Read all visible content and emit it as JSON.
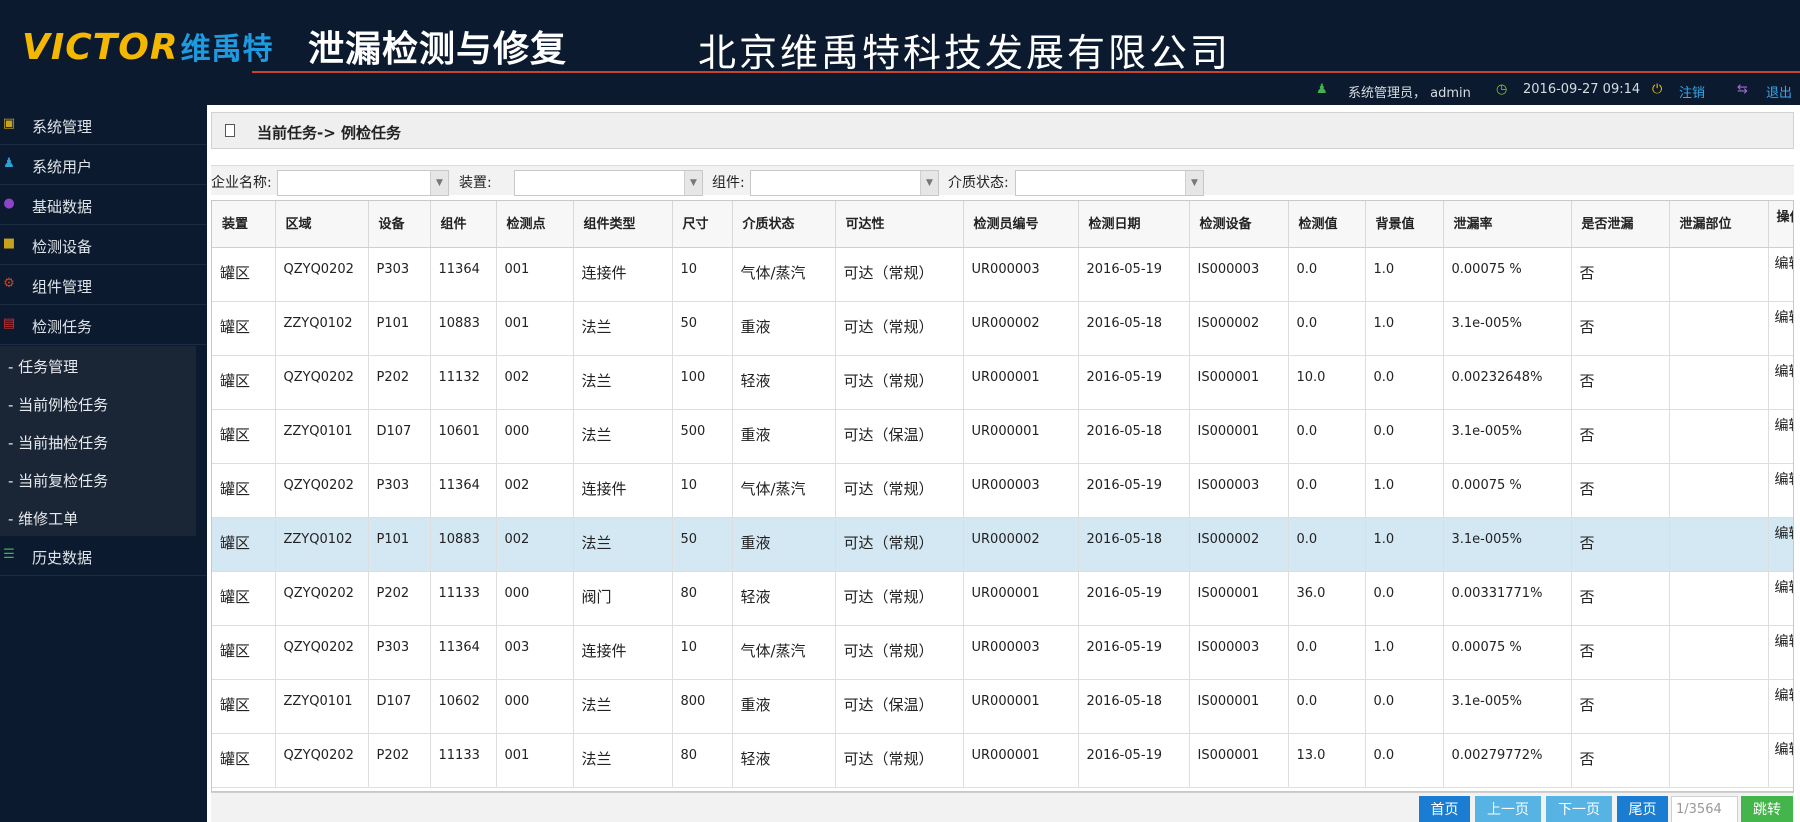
{
  "header": {
    "logo_text": "VICTOR",
    "logo_cn": "维禹特",
    "system_title": "泄漏检测与修复",
    "company": "北京维禹特科技发展有限公司"
  },
  "userbar": {
    "user": "系统管理员， admin",
    "datetime": "2016-09-27 09:14",
    "logout": "注销",
    "exit": "退出"
  },
  "sidebar": {
    "items": [
      {
        "label": "系统管理",
        "icon": "settings-icon"
      },
      {
        "label": "系统用户",
        "icon": "users-icon"
      },
      {
        "label": "基础数据",
        "icon": "globe-icon"
      },
      {
        "label": "检测设备",
        "icon": "truck-icon"
      },
      {
        "label": "组件管理",
        "icon": "cogs-icon"
      },
      {
        "label": "检测任务",
        "icon": "task-icon"
      }
    ],
    "subitems": [
      "- 任务管理",
      "- 当前例检任务",
      "- 当前抽检任务",
      "- 当前复检任务",
      "- 维修工单"
    ],
    "history": {
      "label": "历史数据",
      "icon": "list-icon"
    }
  },
  "breadcrumb": "当前任务-> 例检任务",
  "filters": [
    {
      "label": "企业名称:",
      "value": ""
    },
    {
      "label": "装置:",
      "value": ""
    },
    {
      "label": "组件:",
      "value": ""
    },
    {
      "label": "介质状态:",
      "value": ""
    }
  ],
  "table": {
    "columns": [
      "装置",
      "区域",
      "设备",
      "组件",
      "检测点",
      "组件类型",
      "尺寸",
      "介质状态",
      "可达性",
      "检测员编号",
      "检测日期",
      "检测设备",
      "检测值",
      "背景值",
      "泄漏率",
      "是否泄漏",
      "泄漏部位",
      "操作"
    ],
    "rows": [
      [
        "罐区",
        "QZYQ0202",
        "P303",
        "11364",
        "001",
        "连接件",
        "10",
        "气体/蒸汽",
        "可达（常规）",
        "UR000003",
        "2016-05-19",
        "IS000003",
        "0.0",
        "1.0",
        "0.00075 %",
        "否",
        "",
        "编辑"
      ],
      [
        "罐区",
        "ZZYQ0102",
        "P101",
        "10883",
        "001",
        "法兰",
        "50",
        "重液",
        "可达（常规）",
        "UR000002",
        "2016-05-18",
        "IS000002",
        "0.0",
        "1.0",
        "3.1e-005%",
        "否",
        "",
        "编辑"
      ],
      [
        "罐区",
        "QZYQ0202",
        "P202",
        "11132",
        "002",
        "法兰",
        "100",
        "轻液",
        "可达（常规）",
        "UR000001",
        "2016-05-19",
        "IS000001",
        "10.0",
        "0.0",
        "0.00232648%",
        "否",
        "",
        "编辑"
      ],
      [
        "罐区",
        "ZZYQ0101",
        "D107",
        "10601",
        "000",
        "法兰",
        "500",
        "重液",
        "可达（保温）",
        "UR000001",
        "2016-05-18",
        "IS000001",
        "0.0",
        "0.0",
        "3.1e-005%",
        "否",
        "",
        "编辑"
      ],
      [
        "罐区",
        "QZYQ0202",
        "P303",
        "11364",
        "002",
        "连接件",
        "10",
        "气体/蒸汽",
        "可达（常规）",
        "UR000003",
        "2016-05-19",
        "IS000003",
        "0.0",
        "1.0",
        "0.00075 %",
        "否",
        "",
        "编辑"
      ],
      [
        "罐区",
        "ZZYQ0102",
        "P101",
        "10883",
        "002",
        "法兰",
        "50",
        "重液",
        "可达（常规）",
        "UR000002",
        "2016-05-18",
        "IS000002",
        "0.0",
        "1.0",
        "3.1e-005%",
        "否",
        "",
        "编辑"
      ],
      [
        "罐区",
        "QZYQ0202",
        "P202",
        "11133",
        "000",
        "阀门",
        "80",
        "轻液",
        "可达（常规）",
        "UR000001",
        "2016-05-19",
        "IS000001",
        "36.0",
        "0.0",
        "0.00331771%",
        "否",
        "",
        "编辑"
      ],
      [
        "罐区",
        "QZYQ0202",
        "P303",
        "11364",
        "003",
        "连接件",
        "10",
        "气体/蒸汽",
        "可达（常规）",
        "UR000003",
        "2016-05-19",
        "IS000003",
        "0.0",
        "1.0",
        "0.00075 %",
        "否",
        "",
        "编辑"
      ],
      [
        "罐区",
        "ZZYQ0101",
        "D107",
        "10602",
        "000",
        "法兰",
        "800",
        "重液",
        "可达（保温）",
        "UR000001",
        "2016-05-18",
        "IS000001",
        "0.0",
        "0.0",
        "3.1e-005%",
        "否",
        "",
        "编辑"
      ],
      [
        "罐区",
        "QZYQ0202",
        "P202",
        "11133",
        "001",
        "法兰",
        "80",
        "轻液",
        "可达（常规）",
        "UR000001",
        "2016-05-19",
        "IS000001",
        "13.0",
        "0.0",
        "0.00279772%",
        "否",
        "",
        "编辑"
      ]
    ],
    "highlight_row_index": 5,
    "highlight_color": "#d4e8f4"
  },
  "pager": {
    "first": "首页",
    "prev": "上一页",
    "next": "下一页",
    "last": "尾页",
    "page_input": "1/3564",
    "go": "跳转"
  },
  "colors": {
    "dark_bg": "#0b1a2e",
    "accent_line": "#c9452a",
    "btn_blue": "#1a7dd1",
    "btn_light_blue": "#56b3e3",
    "btn_green": "#43b54a"
  }
}
